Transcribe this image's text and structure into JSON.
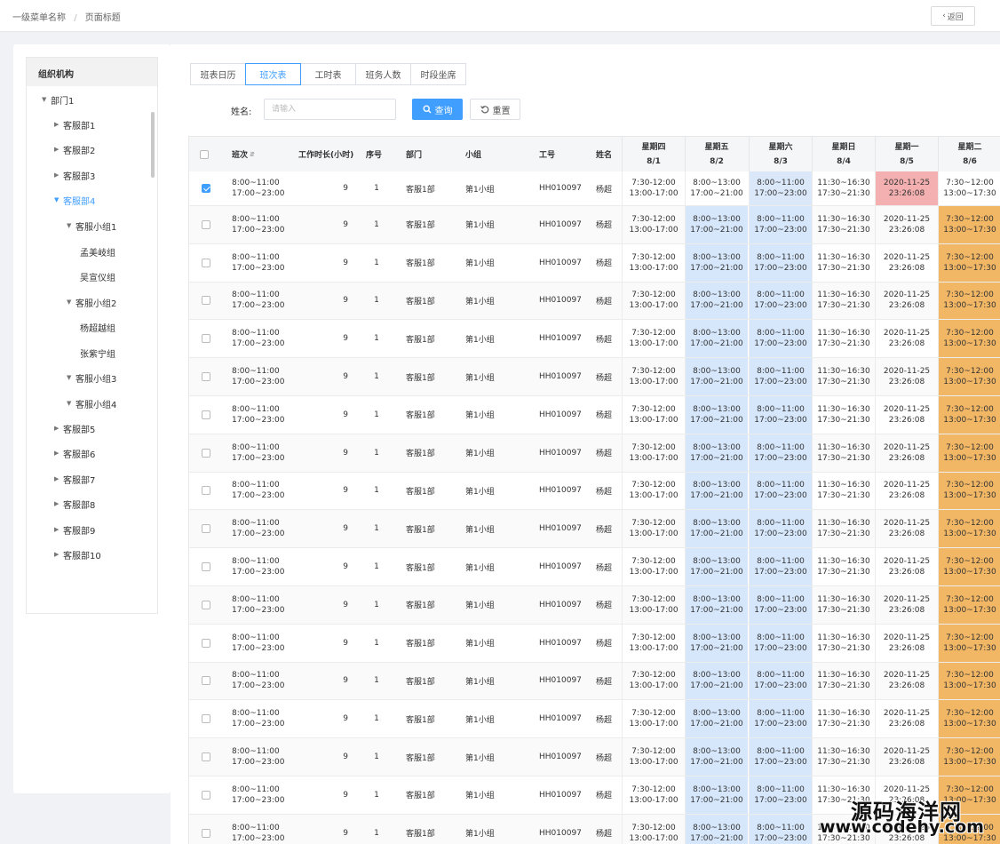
{
  "breadcrumb": {
    "level1": "一级菜单名称",
    "separator": "/",
    "level2": "页面标题"
  },
  "back_button": {
    "icon": "chevron-left-icon",
    "label": "返回"
  },
  "tree": {
    "title": "组织机构",
    "nodes": [
      {
        "label": "部门1",
        "level": 0,
        "caret": "down",
        "active": false
      },
      {
        "label": "客服部1",
        "level": 1,
        "caret": "right",
        "active": false
      },
      {
        "label": "客服部2",
        "level": 1,
        "caret": "right",
        "active": false
      },
      {
        "label": "客服部3",
        "level": 1,
        "caret": "right",
        "active": false
      },
      {
        "label": "客服部4",
        "level": 1,
        "caret": "down",
        "active": true
      },
      {
        "label": "客服小组1",
        "level": 2,
        "caret": "down",
        "active": false
      },
      {
        "label": "孟美岐组",
        "level": 3,
        "caret": "",
        "active": false
      },
      {
        "label": "吴宣仪组",
        "level": 3,
        "caret": "",
        "active": false
      },
      {
        "label": "客服小组2",
        "level": 2,
        "caret": "down",
        "active": false
      },
      {
        "label": "杨超越组",
        "level": 3,
        "caret": "",
        "active": false
      },
      {
        "label": "张紫宁组",
        "level": 3,
        "caret": "",
        "active": false
      },
      {
        "label": "客服小组3",
        "level": 2,
        "caret": "down",
        "active": false
      },
      {
        "label": "客服小组4",
        "level": 2,
        "caret": "down",
        "active": false
      },
      {
        "label": "客服部5",
        "level": 1,
        "caret": "right",
        "active": false
      },
      {
        "label": "客服部6",
        "level": 1,
        "caret": "right",
        "active": false
      },
      {
        "label": "客服部7",
        "level": 1,
        "caret": "right",
        "active": false
      },
      {
        "label": "客服部8",
        "level": 1,
        "caret": "right",
        "active": false
      },
      {
        "label": "客服部9",
        "level": 1,
        "caret": "right",
        "active": false
      },
      {
        "label": "客服部10",
        "level": 1,
        "caret": "right",
        "active": false
      }
    ]
  },
  "tabs": [
    {
      "label": "班表日历",
      "active": false
    },
    {
      "label": "班次表",
      "active": true
    },
    {
      "label": "工时表",
      "active": false
    },
    {
      "label": "班务人数",
      "active": false
    },
    {
      "label": "时段坐席",
      "active": false
    }
  ],
  "search": {
    "name_label": "姓名:",
    "placeholder": "请输入",
    "value": "",
    "query_label": "查询",
    "reset_label": "重置"
  },
  "table": {
    "columns": {
      "shift": "班次",
      "hours": "工作时长(小时)",
      "seq": "序号",
      "dept": "部门",
      "group": "小组",
      "emp_id": "工号",
      "name": "姓名"
    },
    "days": [
      {
        "weekday": "星期四",
        "date": "8/1"
      },
      {
        "weekday": "星期五",
        "date": "8/2"
      },
      {
        "weekday": "星期六",
        "date": "8/3"
      },
      {
        "weekday": "星期日",
        "date": "8/4"
      },
      {
        "weekday": "星期一",
        "date": "8/5"
      },
      {
        "weekday": "星期二",
        "date": "8/6"
      }
    ],
    "colors": {
      "blue": "#d6e7fb",
      "pink": "#f4b0b0",
      "orange": "#f2b765",
      "first_row_blue": "#dbe8fa"
    },
    "row_template": {
      "shift": [
        "8:00~11:00",
        "17:00~23:00"
      ],
      "hours": "9",
      "seq": "1",
      "dept": "客服1部",
      "group": "第1小组",
      "emp_id": "HH010097",
      "name": "杨超",
      "days": [
        [
          "7:30-12:00",
          "13:00-17:00"
        ],
        [
          "8:00~13:00",
          "17:00~21:00"
        ],
        [
          "8:00~11:00",
          "17:00~23:00"
        ],
        [
          "11:30~16:30",
          "17:30~21:30"
        ],
        [
          "2020-11-25",
          "23:26:08"
        ],
        [
          "7:30~12:00",
          "13:00~17:30"
        ]
      ]
    },
    "row_count": 18,
    "checked_rows": [
      0
    ]
  },
  "watermark": {
    "line1": "源码海洋网",
    "line2": "www.codehy.com"
  }
}
